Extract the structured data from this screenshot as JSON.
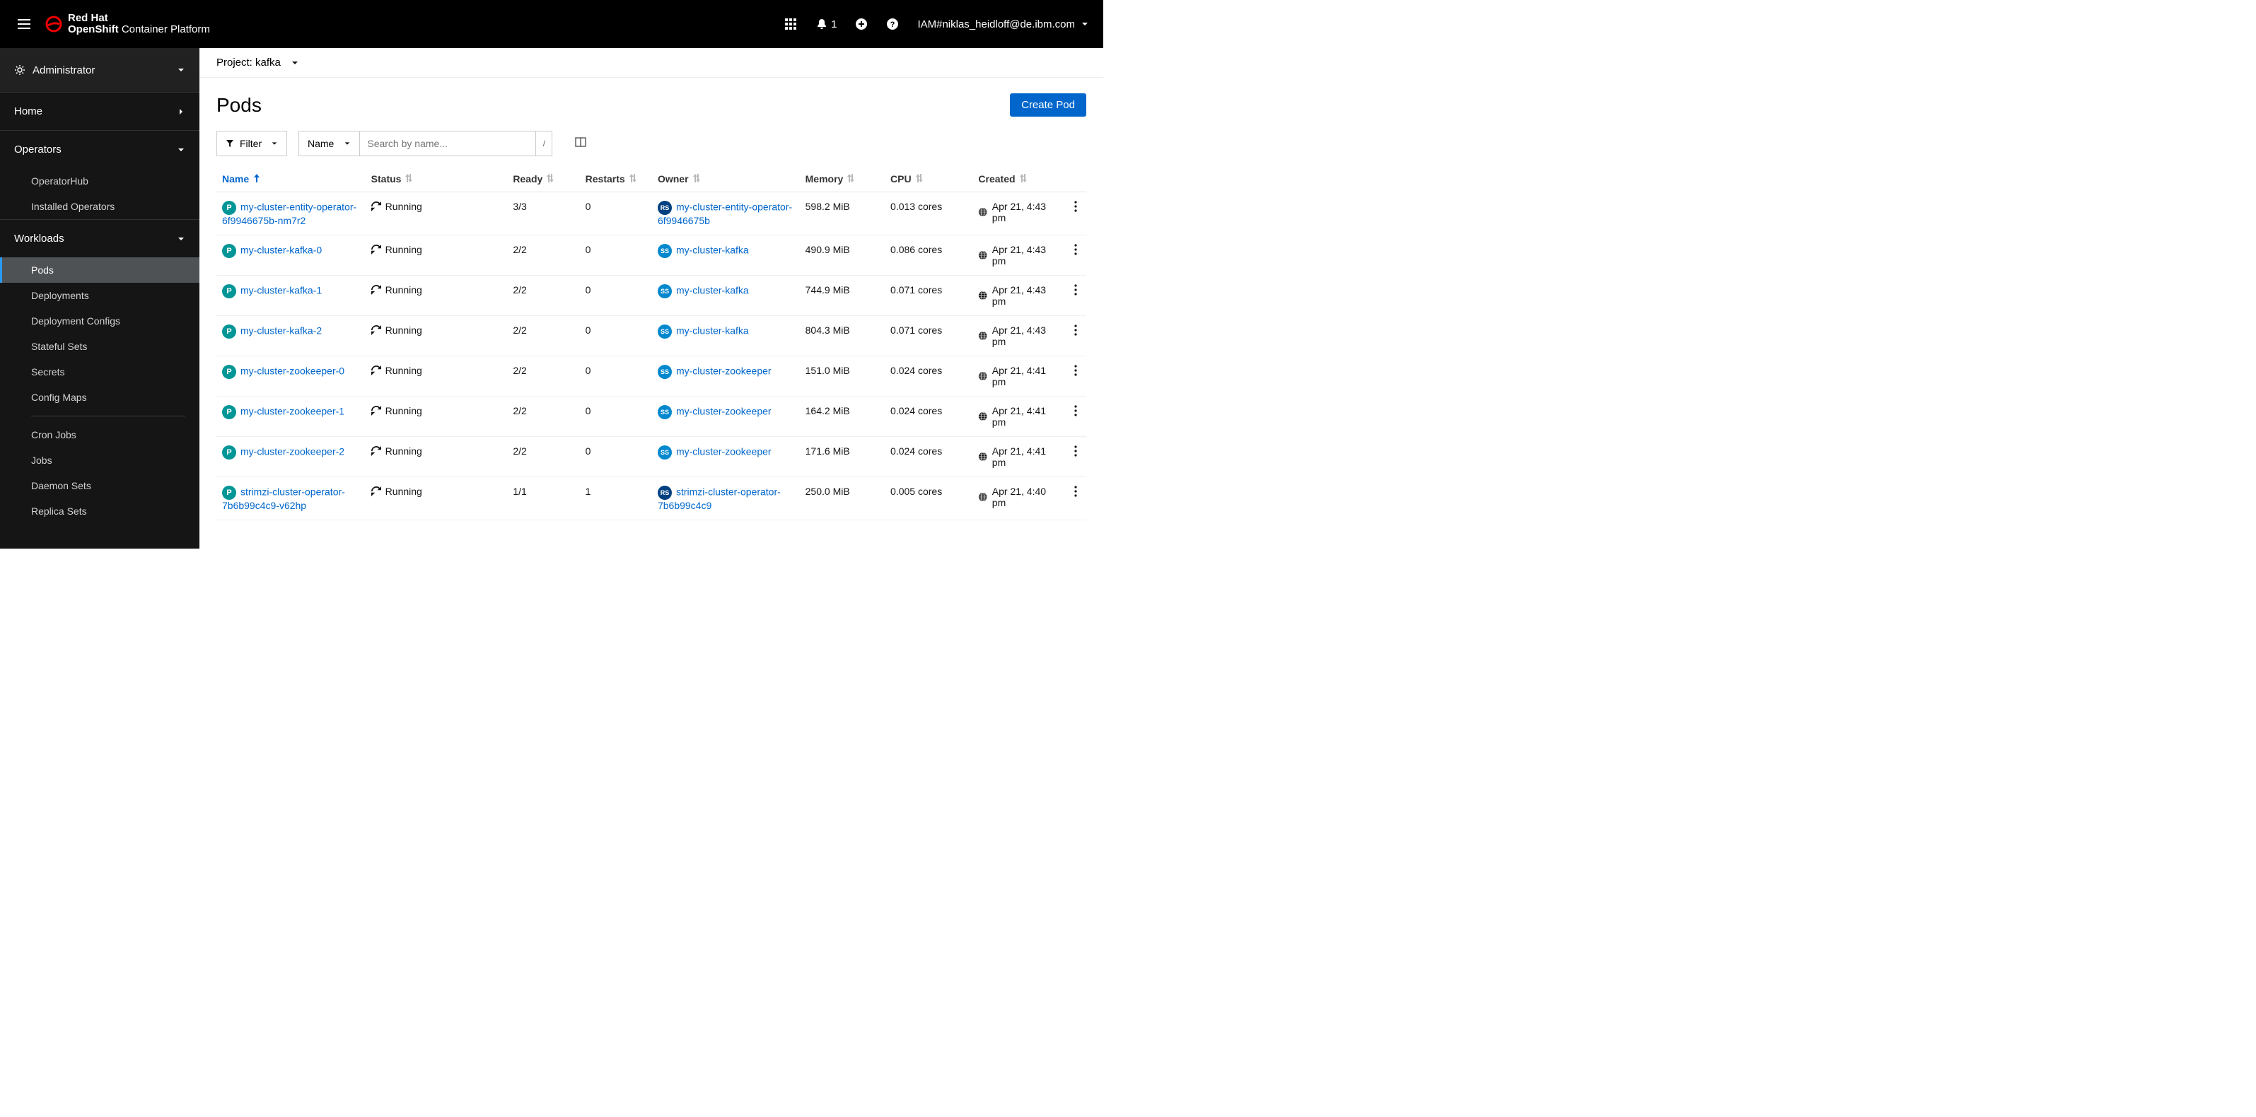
{
  "masthead": {
    "brand_top": "Red Hat",
    "brand_bottom_bold": "OpenShift",
    "brand_bottom_thin": " Container Platform",
    "notif_count": "1",
    "user": "IAM#niklas_heidloff@de.ibm.com"
  },
  "sidebar": {
    "perspective": "Administrator",
    "home": "Home",
    "operators": {
      "label": "Operators",
      "hub": "OperatorHub",
      "installed": "Installed Operators"
    },
    "workloads": {
      "label": "Workloads",
      "pods": "Pods",
      "deployments": "Deployments",
      "dconfigs": "Deployment Configs",
      "ssets": "Stateful Sets",
      "secrets": "Secrets",
      "cmaps": "Config Maps",
      "cron": "Cron Jobs",
      "jobs": "Jobs",
      "dsets": "Daemon Sets",
      "rsets": "Replica Sets"
    }
  },
  "project": {
    "prefix": "Project: ",
    "name": "kafka"
  },
  "page": {
    "title": "Pods",
    "create_btn": "Create Pod"
  },
  "toolbar": {
    "filter": "Filter",
    "name_dd": "Name",
    "search_ph": "Search by name..."
  },
  "table": {
    "headers": {
      "name": "Name",
      "status": "Status",
      "ready": "Ready",
      "restarts": "Restarts",
      "owner": "Owner",
      "memory": "Memory",
      "cpu": "CPU",
      "created": "Created"
    },
    "rows": [
      {
        "name": "my-cluster-entity-operator-6f9946675b-nm7r2",
        "status": "Running",
        "ready": "3/3",
        "restarts": "0",
        "owner_kind": "RS",
        "owner": "my-cluster-entity-operator-6f9946675b",
        "memory": "598.2 MiB",
        "cpu": "0.013 cores",
        "created": "Apr 21, 4:43 pm"
      },
      {
        "name": "my-cluster-kafka-0",
        "status": "Running",
        "ready": "2/2",
        "restarts": "0",
        "owner_kind": "SS",
        "owner": "my-cluster-kafka",
        "memory": "490.9 MiB",
        "cpu": "0.086 cores",
        "created": "Apr 21, 4:43 pm"
      },
      {
        "name": "my-cluster-kafka-1",
        "status": "Running",
        "ready": "2/2",
        "restarts": "0",
        "owner_kind": "SS",
        "owner": "my-cluster-kafka",
        "memory": "744.9 MiB",
        "cpu": "0.071 cores",
        "created": "Apr 21, 4:43 pm"
      },
      {
        "name": "my-cluster-kafka-2",
        "status": "Running",
        "ready": "2/2",
        "restarts": "0",
        "owner_kind": "SS",
        "owner": "my-cluster-kafka",
        "memory": "804.3 MiB",
        "cpu": "0.071 cores",
        "created": "Apr 21, 4:43 pm"
      },
      {
        "name": "my-cluster-zookeeper-0",
        "status": "Running",
        "ready": "2/2",
        "restarts": "0",
        "owner_kind": "SS",
        "owner": "my-cluster-zookeeper",
        "memory": "151.0 MiB",
        "cpu": "0.024 cores",
        "created": "Apr 21, 4:41 pm"
      },
      {
        "name": "my-cluster-zookeeper-1",
        "status": "Running",
        "ready": "2/2",
        "restarts": "0",
        "owner_kind": "SS",
        "owner": "my-cluster-zookeeper",
        "memory": "164.2 MiB",
        "cpu": "0.024 cores",
        "created": "Apr 21, 4:41 pm"
      },
      {
        "name": "my-cluster-zookeeper-2",
        "status": "Running",
        "ready": "2/2",
        "restarts": "0",
        "owner_kind": "SS",
        "owner": "my-cluster-zookeeper",
        "memory": "171.6 MiB",
        "cpu": "0.024 cores",
        "created": "Apr 21, 4:41 pm"
      },
      {
        "name": "strimzi-cluster-operator-7b6b99c4c9-v62hp",
        "status": "Running",
        "ready": "1/1",
        "restarts": "1",
        "owner_kind": "RS",
        "owner": "strimzi-cluster-operator-7b6b99c4c9",
        "memory": "250.0 MiB",
        "cpu": "0.005 cores",
        "created": "Apr 21, 4:40 pm"
      }
    ]
  }
}
